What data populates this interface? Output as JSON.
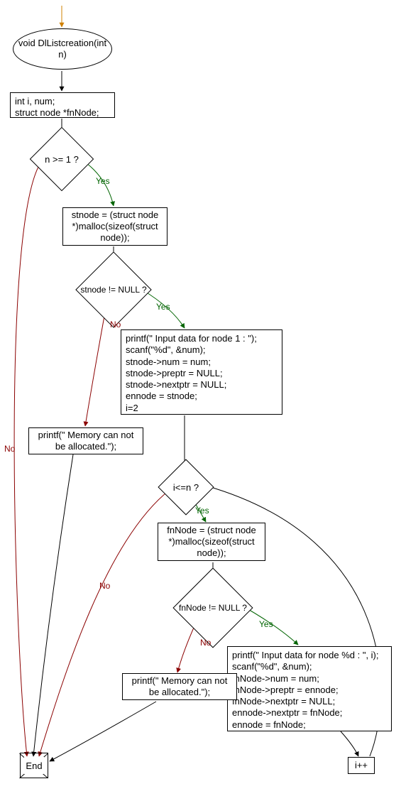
{
  "chart_data": {
    "type": "flowchart",
    "title": "void DlListcreation(int n)",
    "nodes": [
      {
        "id": "start_entry",
        "kind": "entry-arrow"
      },
      {
        "id": "func",
        "kind": "terminal",
        "text": "void DlListcreation(int n)"
      },
      {
        "id": "decl",
        "kind": "process",
        "text": "int i, num;\nstruct node *fnNode;"
      },
      {
        "id": "cond_n",
        "kind": "decision",
        "text": "n >= 1 ?"
      },
      {
        "id": "malloc_st",
        "kind": "process",
        "text": "stnode = (struct node *)malloc(sizeof(struct node));"
      },
      {
        "id": "cond_st",
        "kind": "decision",
        "text": "stnode != NULL ?"
      },
      {
        "id": "init_st",
        "kind": "process",
        "text": "printf(\" Input data for node 1 : \");\nscanf(\"%d\", &num);\nstnode->num = num;\nstnode->preptr = NULL;\nstnode->nextptr = NULL;\nennode = stnode;\ni=2"
      },
      {
        "id": "mem_err1",
        "kind": "process",
        "text": "printf(\" Memory can not be allocated.\");"
      },
      {
        "id": "cond_loop",
        "kind": "decision",
        "text": "i<=n ?"
      },
      {
        "id": "malloc_fn",
        "kind": "process",
        "text": "fnNode = (struct node *)malloc(sizeof(struct node));"
      },
      {
        "id": "cond_fn",
        "kind": "decision",
        "text": "fnNode != NULL ?"
      },
      {
        "id": "init_fn",
        "kind": "process",
        "text": "printf(\" Input data for node %d : \", i);\nscanf(\"%d\", &num);\nfnNode->num = num;\nfnNode->preptr = ennode;\nfnNode->nextptr = NULL;\nennode->nextptr = fnNode;\nennode = fnNode;"
      },
      {
        "id": "mem_err2",
        "kind": "process",
        "text": "printf(\" Memory can not be allocated.\");"
      },
      {
        "id": "incr",
        "kind": "process",
        "text": "i++"
      },
      {
        "id": "end",
        "kind": "terminal-end",
        "text": "End"
      }
    ],
    "edges": [
      {
        "from": "start_entry",
        "to": "func"
      },
      {
        "from": "func",
        "to": "decl"
      },
      {
        "from": "decl",
        "to": "cond_n"
      },
      {
        "from": "cond_n",
        "to": "malloc_st",
        "label": "Yes"
      },
      {
        "from": "cond_n",
        "to": "end",
        "label": "No"
      },
      {
        "from": "malloc_st",
        "to": "cond_st"
      },
      {
        "from": "cond_st",
        "to": "init_st",
        "label": "Yes"
      },
      {
        "from": "cond_st",
        "to": "mem_err1",
        "label": "No"
      },
      {
        "from": "mem_err1",
        "to": "end"
      },
      {
        "from": "init_st",
        "to": "cond_loop"
      },
      {
        "from": "cond_loop",
        "to": "malloc_fn",
        "label": "Yes"
      },
      {
        "from": "cond_loop",
        "to": "end",
        "label": "No"
      },
      {
        "from": "malloc_fn",
        "to": "cond_fn"
      },
      {
        "from": "cond_fn",
        "to": "init_fn",
        "label": "Yes"
      },
      {
        "from": "cond_fn",
        "to": "mem_err2",
        "label": "No"
      },
      {
        "from": "mem_err2",
        "to": "end"
      },
      {
        "from": "init_fn",
        "to": "incr"
      },
      {
        "from": "incr",
        "to": "cond_loop"
      }
    ]
  },
  "nodes": {
    "func": "void DlListcreation(int n)",
    "decl_l1": "int i, num;",
    "decl_l2": "struct node *fnNode;",
    "cond_n": "n >= 1 ?",
    "malloc_st_l1": "stnode = (struct node",
    "malloc_st_l2": "*)malloc(sizeof(struct",
    "malloc_st_l3": "node));",
    "cond_st": "stnode != NULL ?",
    "init_st_l1": "printf(\" Input data for node 1 : \");",
    "init_st_l2": "scanf(\"%d\", &num);",
    "init_st_l3": "stnode->num = num;",
    "init_st_l4": "stnode->preptr = NULL;",
    "init_st_l5": "stnode->nextptr = NULL;",
    "init_st_l6": "ennode = stnode;",
    "init_st_l7": "i=2",
    "mem_err1_l1": "printf(\" Memory can not",
    "mem_err1_l2": "be allocated.\");",
    "cond_loop": "i<=n ?",
    "malloc_fn_l1": "fnNode = (struct node",
    "malloc_fn_l2": "*)malloc(sizeof(struct",
    "malloc_fn_l3": "node));",
    "cond_fn": "fnNode != NULL ?",
    "init_fn_l1": "printf(\" Input data for node %d : \", i);",
    "init_fn_l2": "scanf(\"%d\", &num);",
    "init_fn_l3": "fnNode->num = num;",
    "init_fn_l4": "fnNode->preptr = ennode;",
    "init_fn_l5": "fnNode->nextptr = NULL;",
    "init_fn_l6": "ennode->nextptr = fnNode;",
    "init_fn_l7": "ennode = fnNode;",
    "mem_err2_l1": "printf(\" Memory can not",
    "mem_err2_l2": "be allocated.\");",
    "incr": "i++",
    "end": "End"
  },
  "labels": {
    "yes": "Yes",
    "no": "No"
  }
}
